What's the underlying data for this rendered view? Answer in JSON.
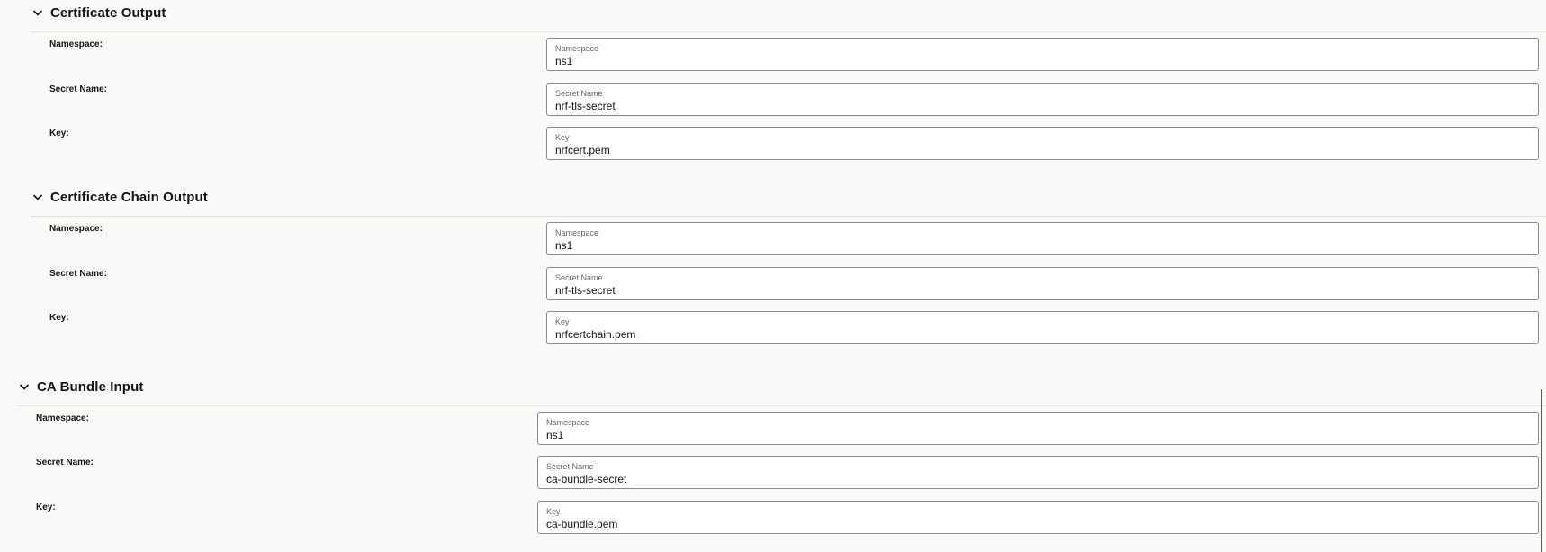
{
  "sections": [
    {
      "title": "Certificate Output",
      "rows": [
        {
          "label": "Namespace:",
          "caption": "Namespace",
          "value": "ns1"
        },
        {
          "label": "Secret Name:",
          "caption": "Secret Name",
          "value": "nrf-tls-secret"
        },
        {
          "label": "Key:",
          "caption": "Key",
          "value": "nrfcert.pem"
        }
      ]
    },
    {
      "title": "Certificate Chain Output",
      "rows": [
        {
          "label": "Namespace:",
          "caption": "Namespace",
          "value": "ns1"
        },
        {
          "label": "Secret Name:",
          "caption": "Secret Name",
          "value": "nrf-tls-secret"
        },
        {
          "label": "Key:",
          "caption": "Key",
          "value": "nrfcertchain.pem"
        }
      ]
    },
    {
      "title": "CA Bundle Input",
      "rows": [
        {
          "label": "Namespace:",
          "caption": "Namespace",
          "value": "ns1"
        },
        {
          "label": "Secret Name:",
          "caption": "Secret Name",
          "value": "ca-bundle-secret"
        },
        {
          "label": "Key:",
          "caption": "Key",
          "value": "ca-bundle.pem"
        }
      ]
    }
  ],
  "icons": {
    "section_toggle": "chevron-down-icon"
  },
  "colors": {
    "background": "#fbf9f8",
    "field_border": "#8d8b88",
    "text": "#161513"
  }
}
